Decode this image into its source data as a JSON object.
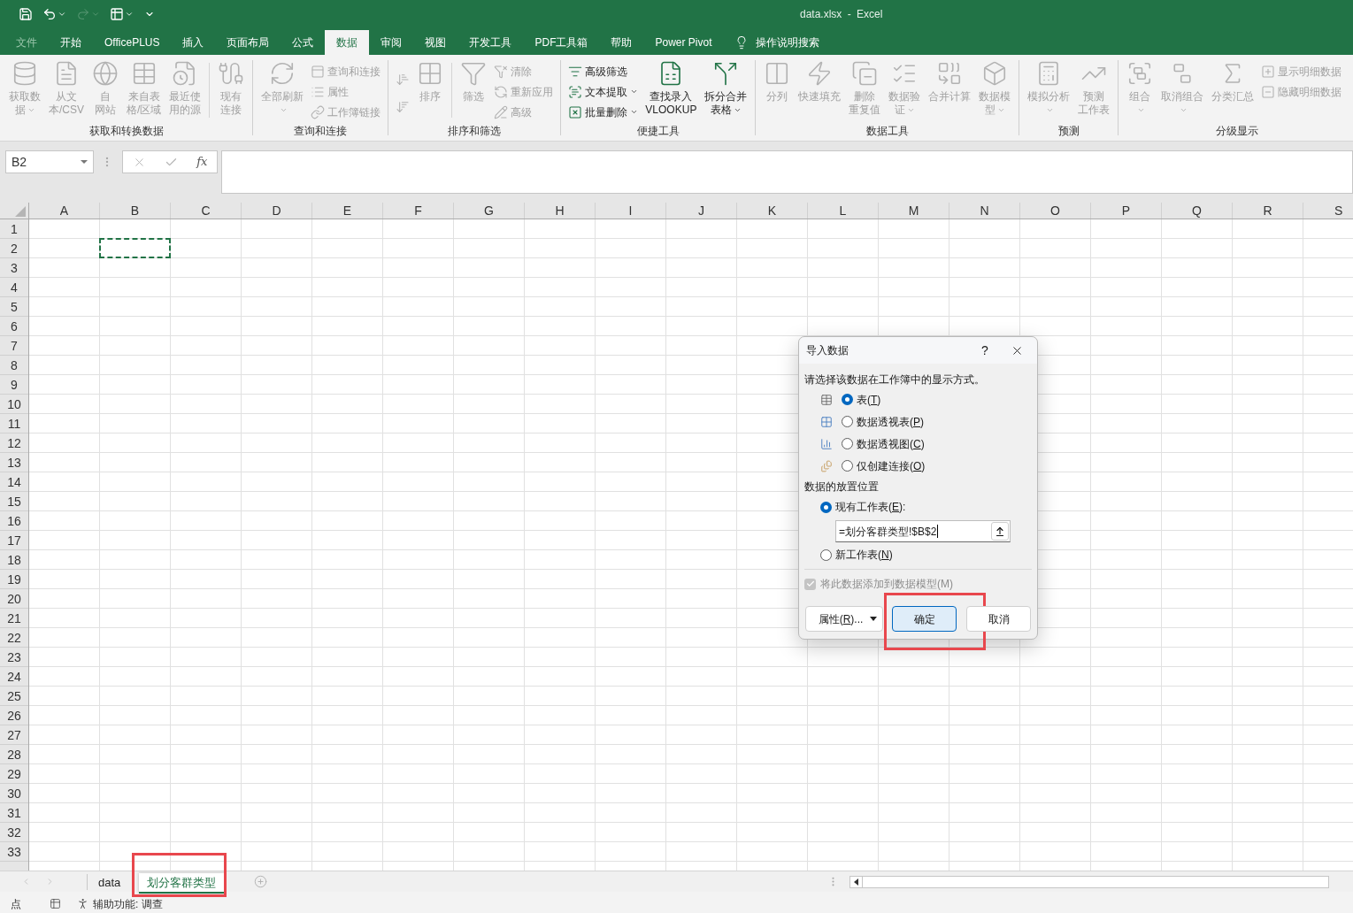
{
  "title_bar": {
    "quick_access": [
      {
        "disabled": false,
        "dropdown": false
      },
      {
        "disabled": false,
        "dropdown": true
      },
      {
        "disabled": true,
        "dropdown": true
      },
      {
        "disabled": false,
        "dropdown": true
      }
    ],
    "title": "data.xlsx - Excel"
  },
  "tabs": [
    {
      "label": "文件",
      "selected": false,
      "disabled": true
    },
    {
      "label": "开始",
      "selected": false,
      "disabled": false
    },
    {
      "label": "OfficePLUS",
      "selected": false,
      "disabled": false
    },
    {
      "label": "插入",
      "selected": false,
      "disabled": false
    },
    {
      "label": "页面布局",
      "selected": false,
      "disabled": false
    },
    {
      "label": "公式",
      "selected": false,
      "disabled": false
    },
    {
      "label": "数据",
      "selected": true,
      "disabled": false
    },
    {
      "label": "审阅",
      "selected": false,
      "disabled": false
    },
    {
      "label": "视图",
      "selected": false,
      "disabled": false
    },
    {
      "label": "开发工具",
      "selected": false,
      "disabled": false
    },
    {
      "label": "PDF工具箱",
      "selected": false,
      "disabled": false
    },
    {
      "label": "帮助",
      "selected": false,
      "disabled": false
    },
    {
      "label": "Power Pivot",
      "selected": false,
      "disabled": false
    }
  ],
  "tell_me": {
    "label": "操作说明搜索"
  },
  "ribbon": {
    "groups": [
      {
        "label": "获取和转换数据",
        "columns": [
          {
            "kind": "large",
            "lines": [
              "获取数",
              "据"
            ],
            "disabled": true,
            "dropdown": true
          },
          {
            "kind": "large",
            "lines": [
              "从文",
              "本/CSV"
            ],
            "disabled": true,
            "dropdown": false
          },
          {
            "kind": "large",
            "lines": [
              "自",
              "网站"
            ],
            "disabled": true,
            "dropdown": false
          },
          {
            "kind": "large",
            "lines": [
              "来自表",
              "格/区域"
            ],
            "disabled": true,
            "dropdown": false
          },
          {
            "kind": "large",
            "lines": [
              "最近使",
              "用的源"
            ],
            "disabled": true,
            "dropdown": false
          },
          {
            "kind": "separator"
          },
          {
            "kind": "large",
            "lines": [
              "现有",
              "连接"
            ],
            "disabled": true,
            "dropdown": false
          }
        ]
      },
      {
        "label": "查询和连接",
        "columns": [
          {
            "kind": "large",
            "lines": [
              "全部刷新"
            ],
            "disabled": true,
            "dropdown": true
          },
          {
            "kind": "stack",
            "items": [
              {
                "label": "查询和连接",
                "disabled": true,
                "dropdown": false
              },
              {
                "label": "属性",
                "disabled": true,
                "dropdown": false
              },
              {
                "label": "工作簿链接",
                "disabled": true,
                "dropdown": false
              }
            ]
          }
        ]
      },
      {
        "label": "排序和筛选",
        "columns": [
          {
            "kind": "stack",
            "items": [
              {
                "disabled": true,
                "dropdown": false
              },
              {
                "disabled": true,
                "dropdown": false
              }
            ]
          },
          {
            "kind": "large",
            "lines": [
              "排序"
            ],
            "disabled": true,
            "dropdown": false
          },
          {
            "kind": "separator"
          },
          {
            "kind": "large",
            "lines": [
              "筛选"
            ],
            "disabled": true,
            "dropdown": false
          },
          {
            "kind": "stack",
            "items": [
              {
                "label": "清除",
                "disabled": true,
                "dropdown": false
              },
              {
                "label": "重新应用",
                "disabled": true,
                "dropdown": false
              },
              {
                "label": "高级",
                "disabled": true,
                "dropdown": false
              }
            ]
          }
        ]
      },
      {
        "label": "便捷工具",
        "columns": [
          {
            "kind": "stack",
            "items": [
              {
                "label": "高级筛选",
                "disabled": false,
                "dropdown": false
              },
              {
                "label": "文本提取",
                "disabled": false,
                "dropdown": true
              },
              {
                "label": "批量删除",
                "disabled": false,
                "dropdown": true
              }
            ]
          },
          {
            "kind": "large",
            "lines": [
              "查找录入",
              "VLOOKUP"
            ],
            "disabled": false,
            "dropdown": false
          },
          {
            "kind": "large",
            "lines": [
              "拆分合并",
              "表格"
            ],
            "disabled": false,
            "dropdown": true
          }
        ]
      },
      {
        "label": "数据工具",
        "columns": [
          {
            "kind": "large",
            "lines": [
              "分列"
            ],
            "disabled": true,
            "dropdown": false
          },
          {
            "kind": "large",
            "lines": [
              "快速填充"
            ],
            "disabled": true,
            "dropdown": false
          },
          {
            "kind": "large",
            "lines": [
              "删除",
              "重复值"
            ],
            "disabled": true,
            "dropdown": false
          },
          {
            "kind": "large",
            "lines": [
              "数据验",
              "证"
            ],
            "disabled": true,
            "dropdown": true
          },
          {
            "kind": "large",
            "lines": [
              "合并计算"
            ],
            "disabled": true,
            "dropdown": false
          },
          {
            "kind": "large",
            "lines": [
              "数据模",
              "型"
            ],
            "disabled": true,
            "dropdown": true
          }
        ]
      },
      {
        "label": "预测",
        "columns": [
          {
            "kind": "large",
            "lines": [
              "模拟分析"
            ],
            "disabled": true,
            "dropdown": true
          },
          {
            "kind": "large",
            "lines": [
              "预测",
              "工作表"
            ],
            "disabled": true,
            "dropdown": false
          }
        ]
      },
      {
        "label": "分级显示",
        "columns": [
          {
            "kind": "large",
            "lines": [
              "组合"
            ],
            "disabled": true,
            "dropdown": true
          },
          {
            "kind": "large",
            "lines": [
              "取消组合"
            ],
            "disabled": true,
            "dropdown": true
          },
          {
            "kind": "large",
            "lines": [
              "分类汇总"
            ],
            "disabled": true,
            "dropdown": false
          },
          {
            "kind": "stack",
            "items": [
              {
                "label": "显示明细数据",
                "disabled": true,
                "dropdown": false
              },
              {
                "label": "隐藏明细数据",
                "disabled": true,
                "dropdown": false
              }
            ]
          }
        ]
      }
    ]
  },
  "formula_bar": {
    "name_box": "B2",
    "insert_function": "fx"
  },
  "sheet": {
    "columns": [
      {
        "label": "A",
        "marquee": false
      },
      {
        "label": "B",
        "marquee": true
      },
      {
        "label": "C",
        "marquee": false
      },
      {
        "label": "D",
        "marquee": false
      },
      {
        "label": "E",
        "marquee": false
      },
      {
        "label": "F",
        "marquee": false
      },
      {
        "label": "G",
        "marquee": false
      },
      {
        "label": "H",
        "marquee": false
      },
      {
        "label": "I",
        "marquee": false
      },
      {
        "label": "J",
        "marquee": false
      },
      {
        "label": "K",
        "marquee": false
      },
      {
        "label": "L",
        "marquee": false
      },
      {
        "label": "M",
        "marquee": false
      },
      {
        "label": "N",
        "marquee": false
      },
      {
        "label": "O",
        "marquee": false
      },
      {
        "label": "P",
        "marquee": false
      },
      {
        "label": "Q",
        "marquee": false
      },
      {
        "label": "R",
        "marquee": false
      },
      {
        "label": "S",
        "marquee": false
      }
    ],
    "rows": [
      {
        "label": "1",
        "marquee": false
      },
      {
        "label": "2",
        "marquee": true
      },
      {
        "label": "3",
        "marquee": false
      },
      {
        "label": "4",
        "marquee": false
      },
      {
        "label": "5",
        "marquee": false
      },
      {
        "label": "6",
        "marquee": false
      },
      {
        "label": "7",
        "marquee": false
      },
      {
        "label": "8",
        "marquee": false
      },
      {
        "label": "9",
        "marquee": false
      },
      {
        "label": "10",
        "marquee": false
      },
      {
        "label": "11",
        "marquee": false
      },
      {
        "label": "12",
        "marquee": false
      },
      {
        "label": "13",
        "marquee": false
      },
      {
        "label": "14",
        "marquee": false
      },
      {
        "label": "15",
        "marquee": false
      },
      {
        "label": "16",
        "marquee": false
      },
      {
        "label": "17",
        "marquee": false
      },
      {
        "label": "18",
        "marquee": false
      },
      {
        "label": "19",
        "marquee": false
      },
      {
        "label": "20",
        "marquee": false
      },
      {
        "label": "21",
        "marquee": false
      },
      {
        "label": "22",
        "marquee": false
      },
      {
        "label": "23",
        "marquee": false
      },
      {
        "label": "24",
        "marquee": false
      },
      {
        "label": "25",
        "marquee": false
      },
      {
        "label": "26",
        "marquee": false
      },
      {
        "label": "27",
        "marquee": false
      },
      {
        "label": "28",
        "marquee": false
      },
      {
        "label": "29",
        "marquee": false
      },
      {
        "label": "30",
        "marquee": false
      },
      {
        "label": "31",
        "marquee": false
      },
      {
        "label": "32",
        "marquee": false
      },
      {
        "label": "33",
        "marquee": false
      }
    ]
  },
  "sheet_tabs": [
    {
      "label": "data",
      "selected": false,
      "highlighted": false
    },
    {
      "label": "划分客群类型",
      "selected": true,
      "highlighted": true
    }
  ],
  "status_bar": {
    "mode": "点",
    "accessibility": "辅助功能: 调查"
  },
  "dialog": {
    "title": "导入数据",
    "help": "?",
    "prompt": "请选择该数据在工作簿中的显示方式。",
    "view_options": [
      {
        "label": "表(",
        "access_key": "T",
        "label_end": ")",
        "selected": true
      },
      {
        "label": "数据透视表(",
        "access_key": "P",
        "label_end": ")",
        "selected": false
      },
      {
        "label": "数据透视图(",
        "access_key": "C",
        "label_end": ")",
        "selected": false
      },
      {
        "label": "仅创建连接(",
        "access_key": "O",
        "label_end": ")",
        "selected": false
      }
    ],
    "placement_heading": "数据的放置位置",
    "placement_options": [
      {
        "label": "现有工作表(",
        "access_key": "E",
        "label_end": "):",
        "selected": true,
        "reference": "=划分客群类型!$B$2"
      },
      {
        "label": "新工作表(",
        "access_key": "N",
        "label_end": ")",
        "selected": false
      }
    ],
    "data_model": {
      "label": "将此数据添加到数据模型(M)",
      "checked": true,
      "disabled": true
    },
    "buttons": [
      {
        "label": "属性(",
        "access_key": "R",
        "label_end": ")...",
        "kind": "menu",
        "default": false,
        "highlighted": false
      },
      {
        "label": "确定",
        "kind": "push",
        "default": true,
        "highlighted": true
      },
      {
        "label": "取消",
        "kind": "push",
        "default": false,
        "highlighted": false
      }
    ]
  }
}
